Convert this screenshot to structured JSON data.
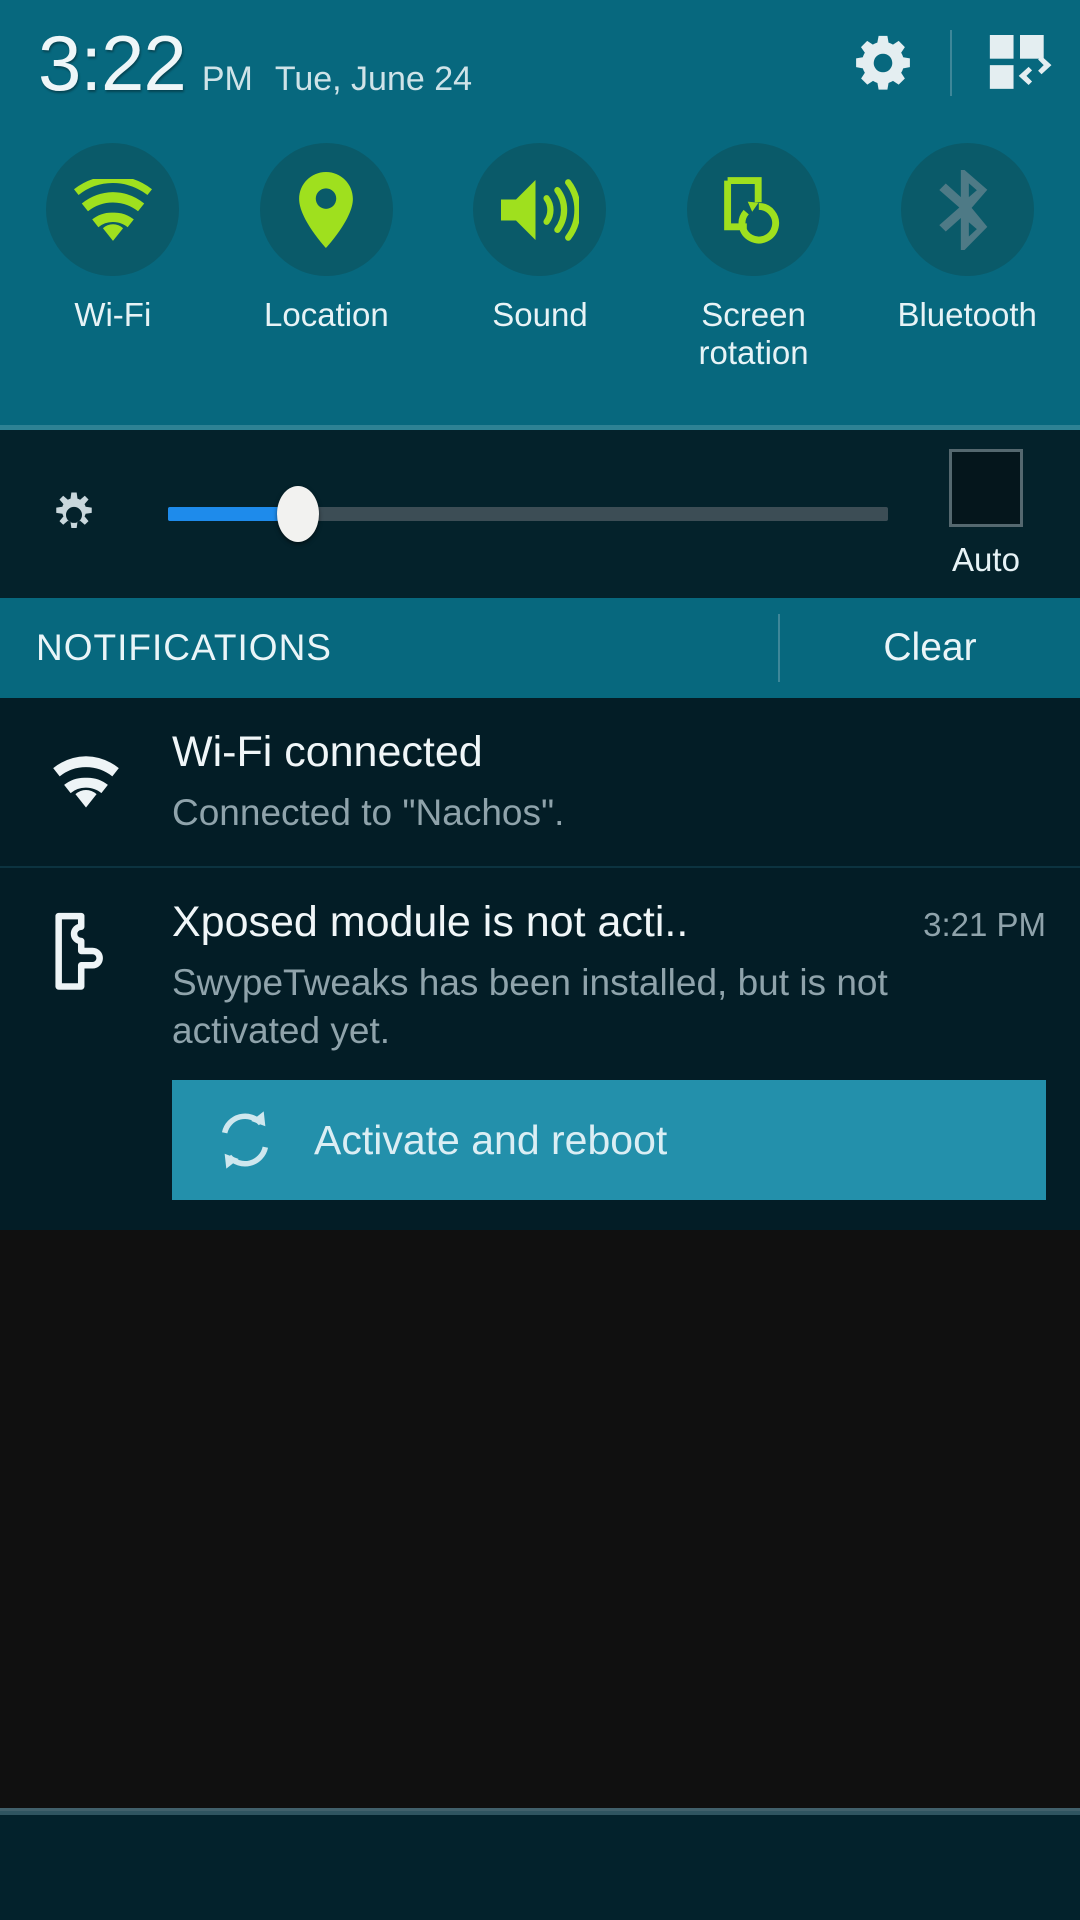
{
  "statusbar": {
    "time": "3:22",
    "ampm": "PM",
    "date": "Tue, June 24",
    "settings_icon": "gear-icon",
    "edit_toggles_icon": "grid-toggle-icon"
  },
  "quick_settings": {
    "toggles": [
      {
        "label": "Wi-Fi",
        "icon": "wifi-icon",
        "state": "on"
      },
      {
        "label": "Location",
        "icon": "location-pin-icon",
        "state": "on"
      },
      {
        "label": "Sound",
        "icon": "sound-speaker-icon",
        "state": "on"
      },
      {
        "label": "Screen\nrotation",
        "label_line1": "Screen",
        "label_line2": "rotation",
        "icon": "screen-rotation-icon",
        "state": "on"
      },
      {
        "label": "Bluetooth",
        "icon": "bluetooth-icon",
        "state": "off"
      }
    ]
  },
  "brightness": {
    "icon": "brightness-gear-icon",
    "value_percent": 18,
    "auto_label": "Auto",
    "auto_checked": false
  },
  "notifications_header": {
    "title": "NOTIFICATIONS",
    "clear_label": "Clear"
  },
  "notifications": [
    {
      "icon": "wifi-icon",
      "title": "Wi-Fi connected",
      "subtitle": "Connected to \"Nachos\".",
      "time": ""
    },
    {
      "icon": "xposed-puzzle-icon",
      "title": "Xposed module is not acti..",
      "subtitle": "SwypeTweaks has been installed, but is not activated yet.",
      "time": "3:21 PM",
      "action": {
        "label": "Activate and reboot",
        "icon": "sync-reboot-icon"
      }
    }
  ],
  "colors": {
    "panel_teal": "#07687E",
    "toggle_circle": "#0A5A69",
    "toggle_on_green": "#9FE01E",
    "toggle_off_gray": "#4E7A86",
    "notif_bg": "#031D26",
    "slider_blue": "#1E8BEB",
    "action_button": "#2390AB"
  }
}
